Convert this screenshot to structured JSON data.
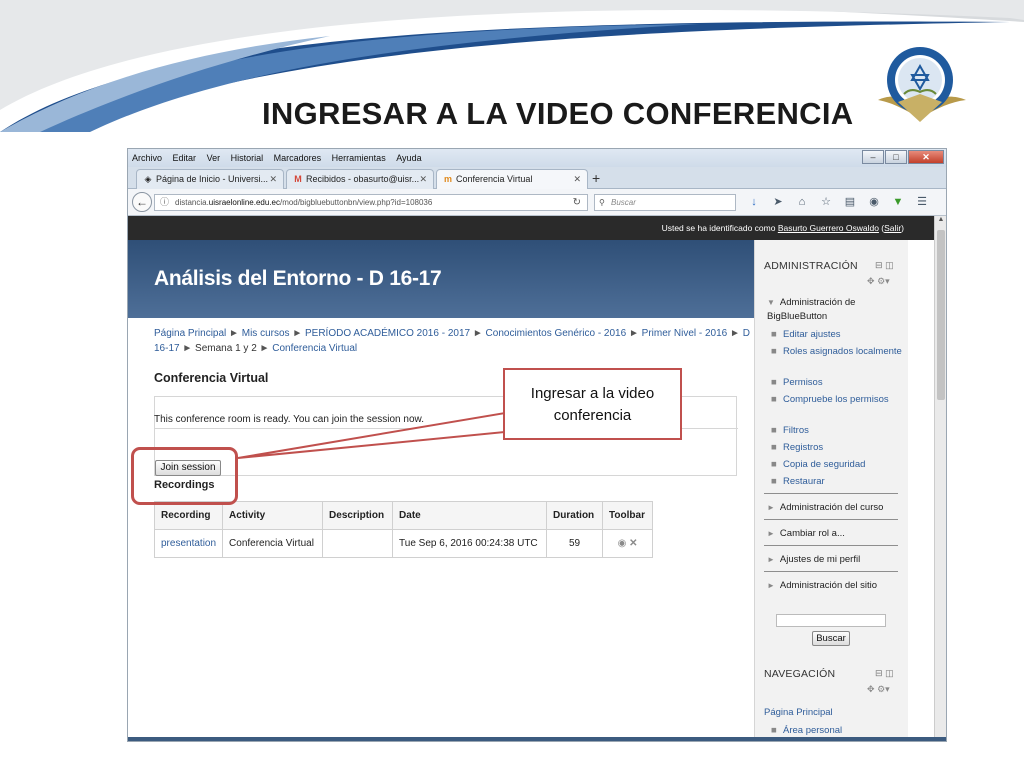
{
  "slide": {
    "title": "INGRESAR A LA VIDEO CONFERENCIA",
    "callout_text": "Ingresar a la video conferencia"
  },
  "browser": {
    "menu": [
      "Archivo",
      "Editar",
      "Ver",
      "Historial",
      "Marcadores",
      "Herramientas",
      "Ayuda"
    ],
    "tabs": [
      {
        "label": "Página de Inicio - Universi...",
        "icon": "globe-icon"
      },
      {
        "label": "Recibidos - obasurto@uisr...",
        "icon": "gmail-icon"
      },
      {
        "label": "Conferencia Virtual",
        "icon": "moodle-icon"
      }
    ],
    "url_prefix": "distancia.",
    "url_domain": "uisraelonline.edu.ec",
    "url_path": "/mod/bigbluebuttonbn/view.php?id=108036",
    "search_placeholder": "Buscar"
  },
  "page": {
    "user_bar_prefix": "Usted se ha identificado como",
    "user_name": "Basurto Guerrero Oswaldo",
    "logout_label": "Salir",
    "course_title": "Análisis del Entorno - D 16-17",
    "breadcrumb": [
      "Página Principal",
      "Mis cursos",
      "PERÍODO ACADÉMICO 2016 - 2017",
      "Conocimientos Genérico - 2016",
      "Primer Nivel - 2016",
      "D 16-17",
      "Semana 1 y 2",
      "Conferencia Virtual"
    ],
    "section_title": "Conferencia Virtual",
    "ready_message": "This conference room is ready. You can join the session now.",
    "join_button": "Join session",
    "recordings_title": "Recordings",
    "table": {
      "headers": [
        "Recording",
        "Activity",
        "Description",
        "Date",
        "Duration",
        "Toolbar"
      ],
      "rows": [
        [
          "presentation",
          "Conferencia Virtual",
          "",
          "Tue Sep 6, 2016 00:24:38 UTC",
          "59",
          ""
        ]
      ]
    }
  },
  "sidebar": {
    "admin_title": "ADMINISTRACIÓN",
    "bbb_node": "Administración de BigBlueButton",
    "bbb_items": [
      "Editar ajustes",
      "Roles asignados localmente",
      "Permisos",
      "Compruebe los permisos",
      "Filtros",
      "Registros",
      "Copia de seguridad",
      "Restaurar"
    ],
    "nodes": [
      "Administración del curso",
      "Cambiar rol a...",
      "Ajustes de mi perfil",
      "Administración del sitio"
    ],
    "search_button": "Buscar",
    "nav_title": "NAVEGACIÓN",
    "nav_links": [
      "Página Principal",
      "Área personal"
    ]
  },
  "colors": {
    "accent_red": "#c0504d",
    "header_blue": "#2f4f77",
    "link_blue": "#2f5d9a",
    "swoosh_blue": "#1f4e8c"
  }
}
